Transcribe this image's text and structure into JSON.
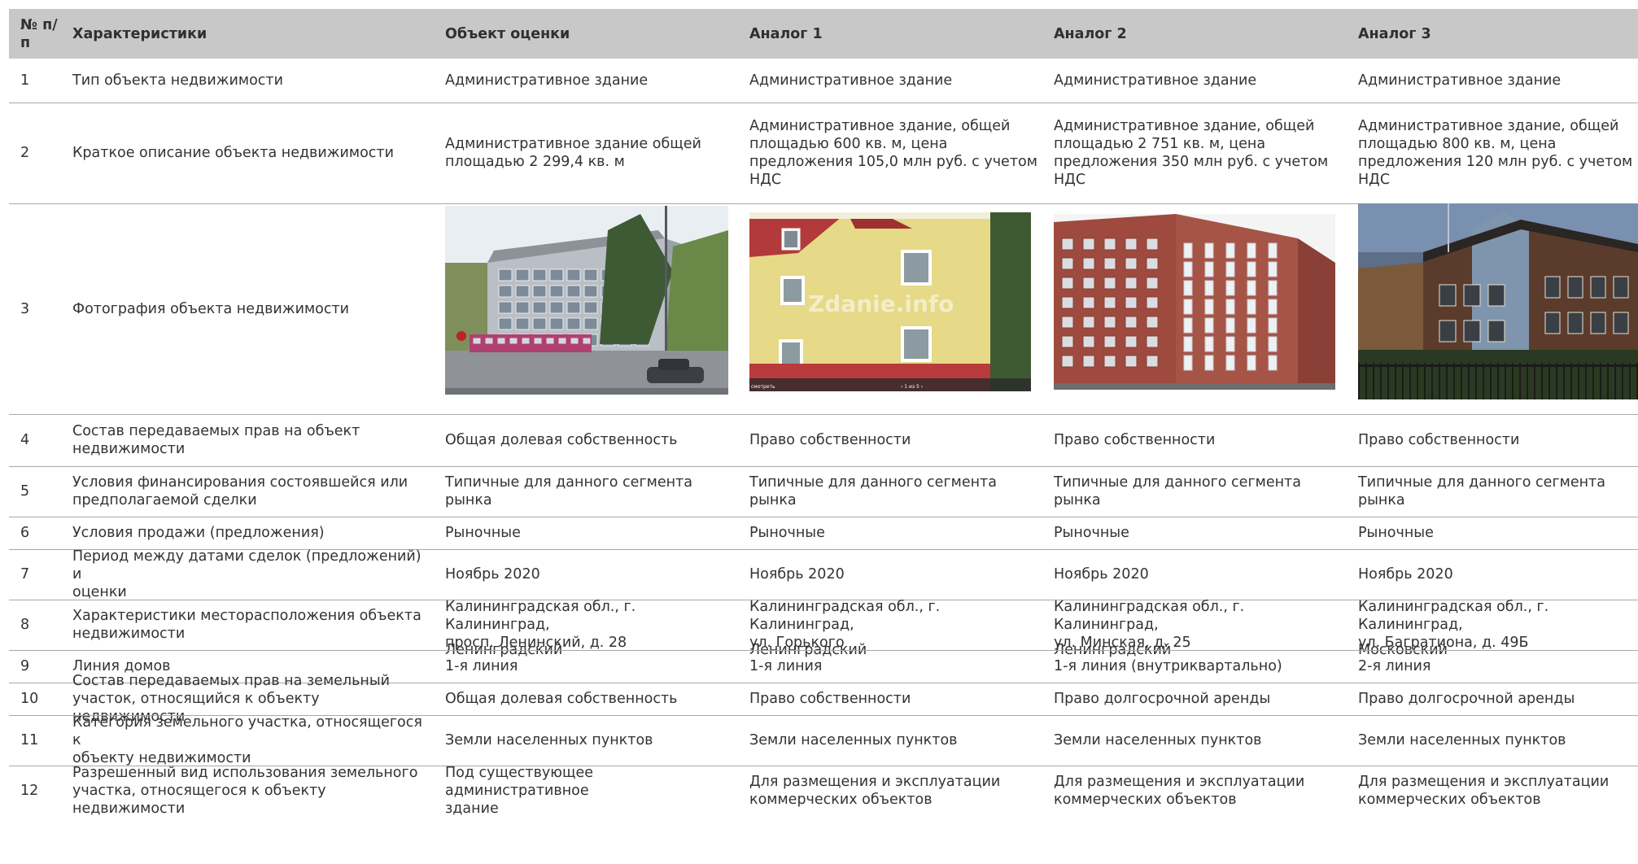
{
  "header": {
    "num": "№\nп/п",
    "characteristics": "Характеристики",
    "columns": [
      "Объект оценки",
      "Аналог 1",
      "Аналог 2",
      "Аналог 3"
    ]
  },
  "rows": [
    {
      "num": "1",
      "label": "Тип объекта недвижимости",
      "values": [
        "Административное здание",
        "Административное здание",
        "Административное здание",
        "Административное здание"
      ]
    },
    {
      "num": "2",
      "label": "Краткое описание объекта недвижимости",
      "values": [
        "Административное здание общей\nплощадью 2 299,4 кв. м",
        "Административное здание, общей\nплощадью 600 кв. м, цена\nпредложения 105,0 млн руб. с учетом\nНДС",
        "Административное здание, общей\nплощадью 2 751 кв. м, цена\nпредложения 350 млн руб. с учетом\nНДС",
        "Административное здание, общей\nплощадью 800 кв. м, цена\nпредложения 120 млн руб. с учетом\nНДС"
      ]
    },
    {
      "num": "3",
      "label": "Фотография объекта недвижимости",
      "photos": [
        "grey-office-building-photo",
        "yellow-house-photo",
        "red-brick-building-photo",
        "dark-brick-building-photo"
      ],
      "watermark": "Zdanie.info",
      "photo_caption_left": "смотреть",
      "photo_caption_pager": "1 из 5"
    },
    {
      "num": "4",
      "label": "Состав передаваемых прав на объект\nнедвижимости",
      "values": [
        "Общая долевая собственность",
        "Право собственности",
        "Право собственности",
        "Право собственности"
      ]
    },
    {
      "num": "5",
      "label": "Условия финансирования состоявшейся или\nпредполагаемой сделки",
      "values": [
        "Типичные для данного сегмента рынка",
        "Типичные для данного сегмента рынка",
        "Типичные для данного сегмента рынка",
        "Типичные для данного сегмента рынка"
      ]
    },
    {
      "num": "6",
      "label": "Условия продажи (предложения)",
      "values": [
        "Рыночные",
        "Рыночные",
        "Рыночные",
        "Рыночные"
      ]
    },
    {
      "num": "7",
      "label": "Период между датами сделок (предложений) и\nоценки",
      "values": [
        "Ноябрь 2020",
        "Ноябрь 2020",
        "Ноябрь 2020",
        "Ноябрь 2020"
      ]
    },
    {
      "num": "8",
      "label": "Характеристики месторасположения объекта\nнедвижимости",
      "values": [
        "Калининградская обл., г. Калининград,\nпросп. Ленинский, д. 28",
        "Калининградская обл., г. Калининград,\nул. Горького",
        "Калининградская обл., г. Калининград,\nул. Минская, д. 25",
        "Калининградская обл., г. Калининград,\nул. Багратиона, д. 49Б"
      ],
      "district": [
        "Ленинградский",
        "Ленинградский",
        "Ленинградский",
        "Московский"
      ]
    },
    {
      "num": "9",
      "label": "Линия домов",
      "values": [
        "1-я линия",
        "1-я линия",
        "1-я линия (внутриквартально)",
        "2-я линия"
      ]
    },
    {
      "num": "10",
      "label": "Состав передаваемых прав на земельный\nучасток, относящийся к объекту недвижимости",
      "values": [
        "Общая долевая собственность",
        "Право собственности",
        "Право долгосрочной аренды",
        "Право долгосрочной аренды"
      ]
    },
    {
      "num": "11",
      "label": "Категория земельного участка, относящегося к\nобъекту недвижимости",
      "values": [
        "Земли населенных пунктов",
        "Земли населенных пунктов",
        "Земли населенных пунктов",
        "Земли населенных пунктов"
      ]
    },
    {
      "num": "12",
      "label": "Разрешенный вид использования земельного\nучастка, относящегося к объекту недвижимости",
      "values": [
        "Под существующее административное\nздание",
        "Для размещения и эксплуатации\nкоммерческих объектов",
        "Для размещения и эксплуатации\nкоммерческих объектов",
        "Для размещения и эксплуатации\nкоммерческих объектов"
      ]
    }
  ]
}
